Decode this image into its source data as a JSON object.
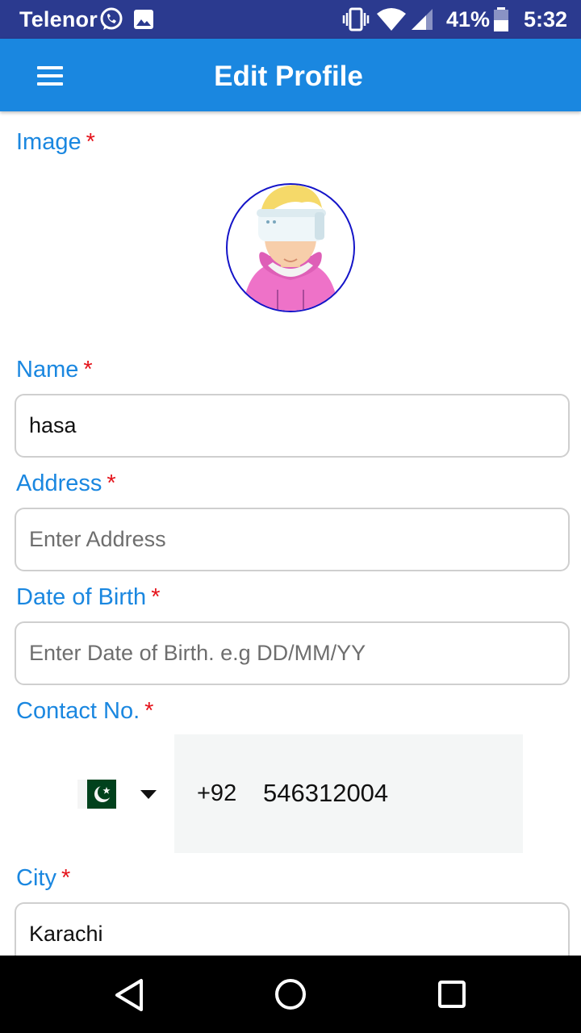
{
  "status_bar": {
    "carrier": "Telenor",
    "battery_percent": "41%",
    "time": "5:32",
    "icons": [
      "whatsapp-icon",
      "gallery-icon",
      "vibrate-icon",
      "wifi-icon",
      "signal-icon",
      "battery-icon"
    ]
  },
  "app_bar": {
    "title": "Edit Profile",
    "menu_icon": "hamburger-menu-icon"
  },
  "form": {
    "required_marker": "*",
    "image_label": "Image",
    "name": {
      "label": "Name",
      "value": "hasa",
      "placeholder": ""
    },
    "address": {
      "label": "Address",
      "value": "",
      "placeholder": "Enter Address"
    },
    "dob": {
      "label": "Date of Birth",
      "value": "",
      "placeholder": "Enter Date of Birth. e.g DD/MM/YY"
    },
    "contact": {
      "label": "Contact No.",
      "country_flag": "pakistan-flag-icon",
      "dial_code": "+92",
      "number": "546312004"
    },
    "city": {
      "label": "City",
      "value": "Karachi",
      "placeholder": ""
    }
  },
  "nav_bar": {
    "icons": [
      "back-triangle-icon",
      "home-circle-icon",
      "recents-square-icon"
    ]
  },
  "colors": {
    "status_bar": "#2b3a8f",
    "app_bar": "#1a87e0",
    "label": "#1a87e0",
    "required": "#e5141c",
    "avatar_border": "#1414c8"
  }
}
